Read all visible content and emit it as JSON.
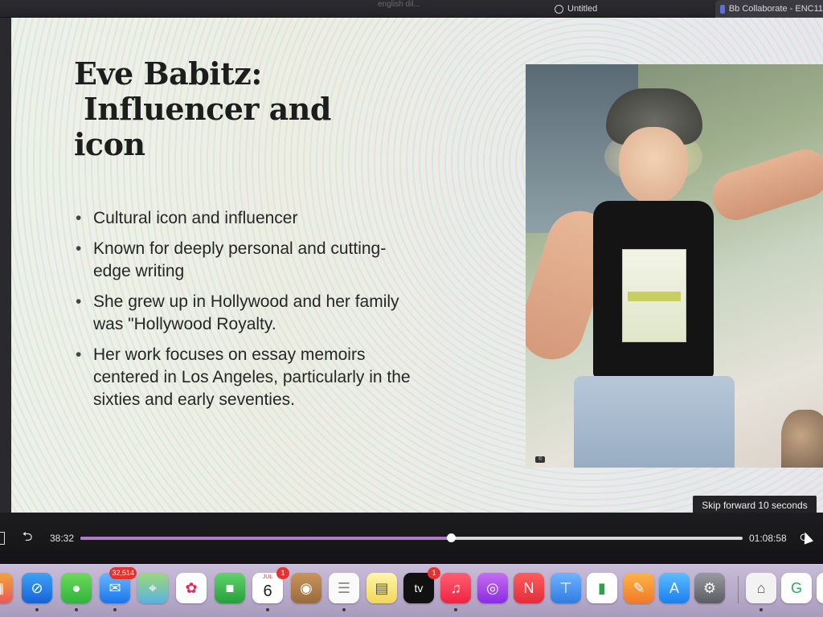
{
  "browser": {
    "tabs": [
      {
        "label": "english dil...",
        "faded": true
      },
      {
        "label": "Untitled"
      },
      {
        "label": "Bb Collaborate - ENC11"
      }
    ]
  },
  "slide": {
    "title_lines": [
      "Eve Babitz:",
      "Influencer and",
      "icon"
    ],
    "bullets": [
      "Cultural icon and influencer",
      "Known for deeply personal and cutting-edge writing",
      "She grew up in Hollywood and her family was \"Hollywood Royalty.",
      "Her work focuses on essay memoirs centered in Los Angeles, particularly in the sixties and early seventies."
    ]
  },
  "player": {
    "tooltip": "Skip forward 10 seconds",
    "current_time": "38:32",
    "total_time": "01:08:58",
    "progress": 0.5589
  },
  "dock": {
    "mail_badge": "32,514",
    "calendar_month": "JUL",
    "calendar_day": "6",
    "calendar_badge": "1",
    "tv_label": "tv",
    "tv_badge": "1"
  },
  "colors": {
    "progress_fill": "#b37ac9",
    "badge": "#e5322d"
  }
}
